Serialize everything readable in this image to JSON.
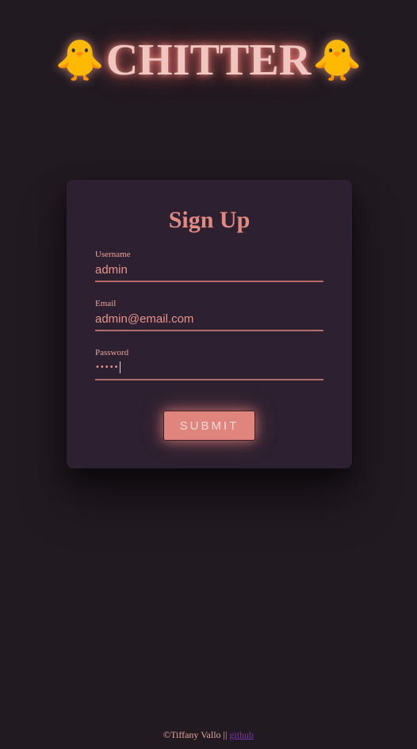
{
  "header": {
    "brand": "CHITTER",
    "left_emoji": "🐥",
    "right_emoji": "🐥"
  },
  "form": {
    "title": "Sign Up",
    "username": {
      "label": "Username",
      "value": "admin"
    },
    "email": {
      "label": "Email",
      "value": "admin@email.com"
    },
    "password": {
      "label": "Password",
      "masked_value": "•••••"
    },
    "submit_label": "SUBMIT"
  },
  "footer": {
    "text": "©Tiffany Vallo || ",
    "link_label": "github"
  },
  "colors": {
    "background": "#211a21",
    "card": "#2d2030",
    "accent": "#e0847e",
    "brand_glow": "#f0c6c0",
    "link": "#7a35a8"
  }
}
